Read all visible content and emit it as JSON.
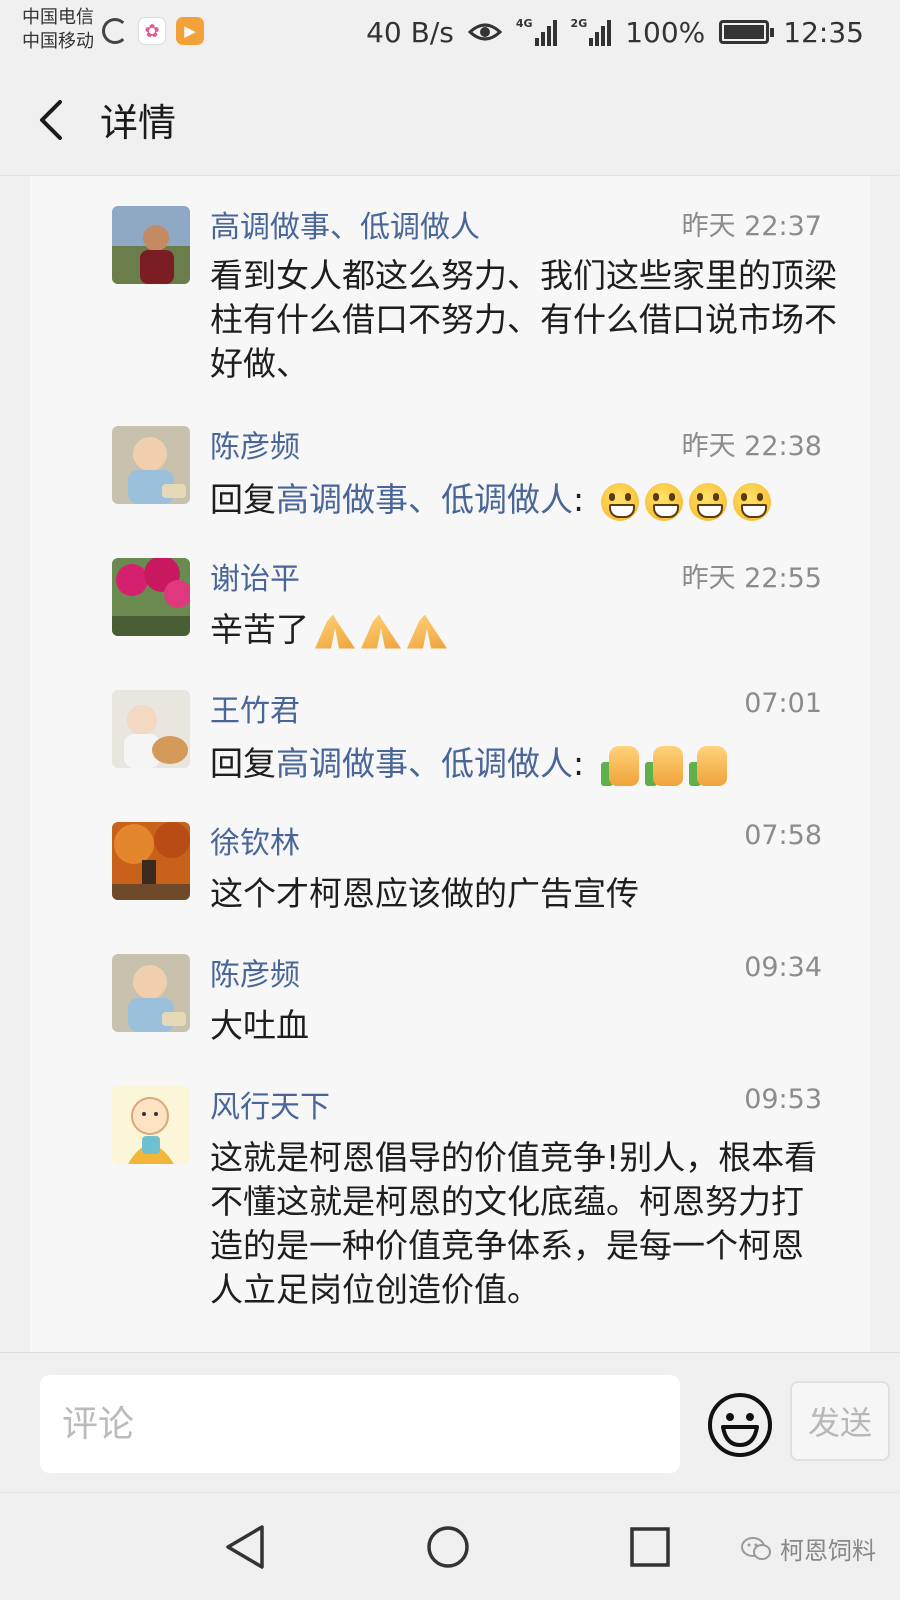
{
  "status_bar": {
    "carrier_1": "中国电信",
    "carrier_2": "中国移动",
    "net_speed": "40 B/s",
    "signal_1_label": "4G",
    "signal_2_label": "2G",
    "battery": "100%",
    "time": "12:35"
  },
  "header": {
    "title": "详情"
  },
  "comments": [
    {
      "name": "高调做事、低调做人",
      "time": "昨天 22:37",
      "text": "看到女人都这么努力、我们这些家里的顶梁柱有什么借口不努力、有什么借口说市场不好做、"
    },
    {
      "name": "陈彦频",
      "time": "昨天 22:38",
      "reply_prefix": "回复",
      "reply_target": "高调做事、低调做人",
      "reply_colon": ":",
      "emoji": "grinning-face x4"
    },
    {
      "name": "谢诒平",
      "time": "昨天 22:55",
      "text": "辛苦了",
      "emoji": "praying-hands x3"
    },
    {
      "name": "王竹君",
      "time": "07:01",
      "reply_prefix": "回复",
      "reply_target": "高调做事、低调做人",
      "reply_colon": ":",
      "emoji": "thumbs-up x3"
    },
    {
      "name": "徐钦林",
      "time": "07:58",
      "text": "这个才柯恩应该做的广告宣传"
    },
    {
      "name": "陈彦频",
      "time": "09:34",
      "text": "大吐血"
    },
    {
      "name": "风行天下",
      "time": "09:53",
      "text": "这就是柯恩倡导的价值竞争!别人，根本看不懂这就是柯恩的文化底蕴。柯恩努力打造的是一种价值竞争体系，是每一个柯恩人立足岗位创造价值。"
    }
  ],
  "input_bar": {
    "placeholder": "评论",
    "send_label": "发送"
  },
  "watermark": "柯恩饲料",
  "colors": {
    "name_blue": "#4a6699",
    "time_gray": "#8c8c8c",
    "background": "#f0f0f0",
    "card": "#f7f7f7"
  }
}
